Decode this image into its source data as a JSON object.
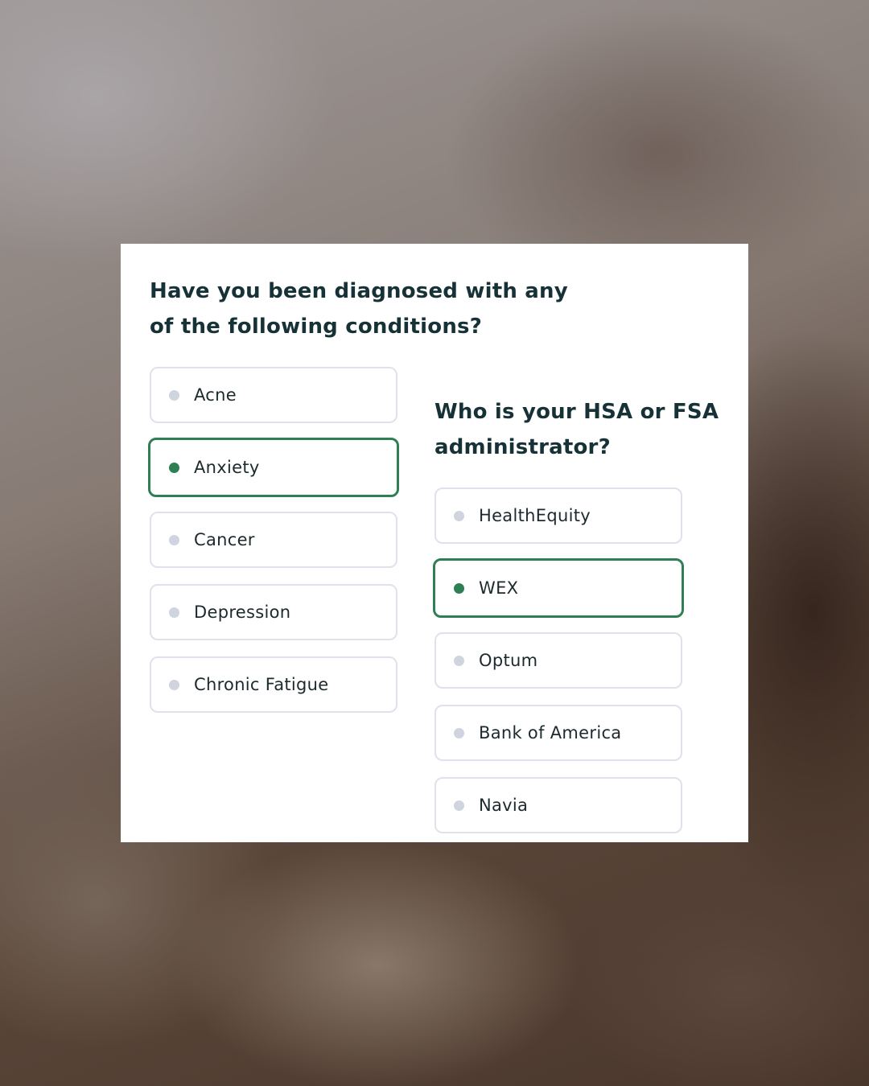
{
  "survey": {
    "conditions": {
      "question": "Have you been diagnosed with any of the following conditions?",
      "options": [
        {
          "label": "Acne",
          "selected": false
        },
        {
          "label": "Anxiety",
          "selected": true
        },
        {
          "label": "Cancer",
          "selected": false
        },
        {
          "label": "Depression",
          "selected": false
        },
        {
          "label": "Chronic Fatigue",
          "selected": false
        }
      ]
    },
    "administrator": {
      "question": "Who is your HSA or FSA administrator?",
      "options": [
        {
          "label": "HealthEquity",
          "selected": false
        },
        {
          "label": "WEX",
          "selected": true
        },
        {
          "label": "Optum",
          "selected": false
        },
        {
          "label": "Bank of America",
          "selected": false
        },
        {
          "label": "Navia",
          "selected": false
        }
      ]
    }
  },
  "colors": {
    "accent": "#2f7f55",
    "heading": "#163236",
    "border": "#dfe2ea",
    "dot_inactive": "#cfd4de"
  }
}
